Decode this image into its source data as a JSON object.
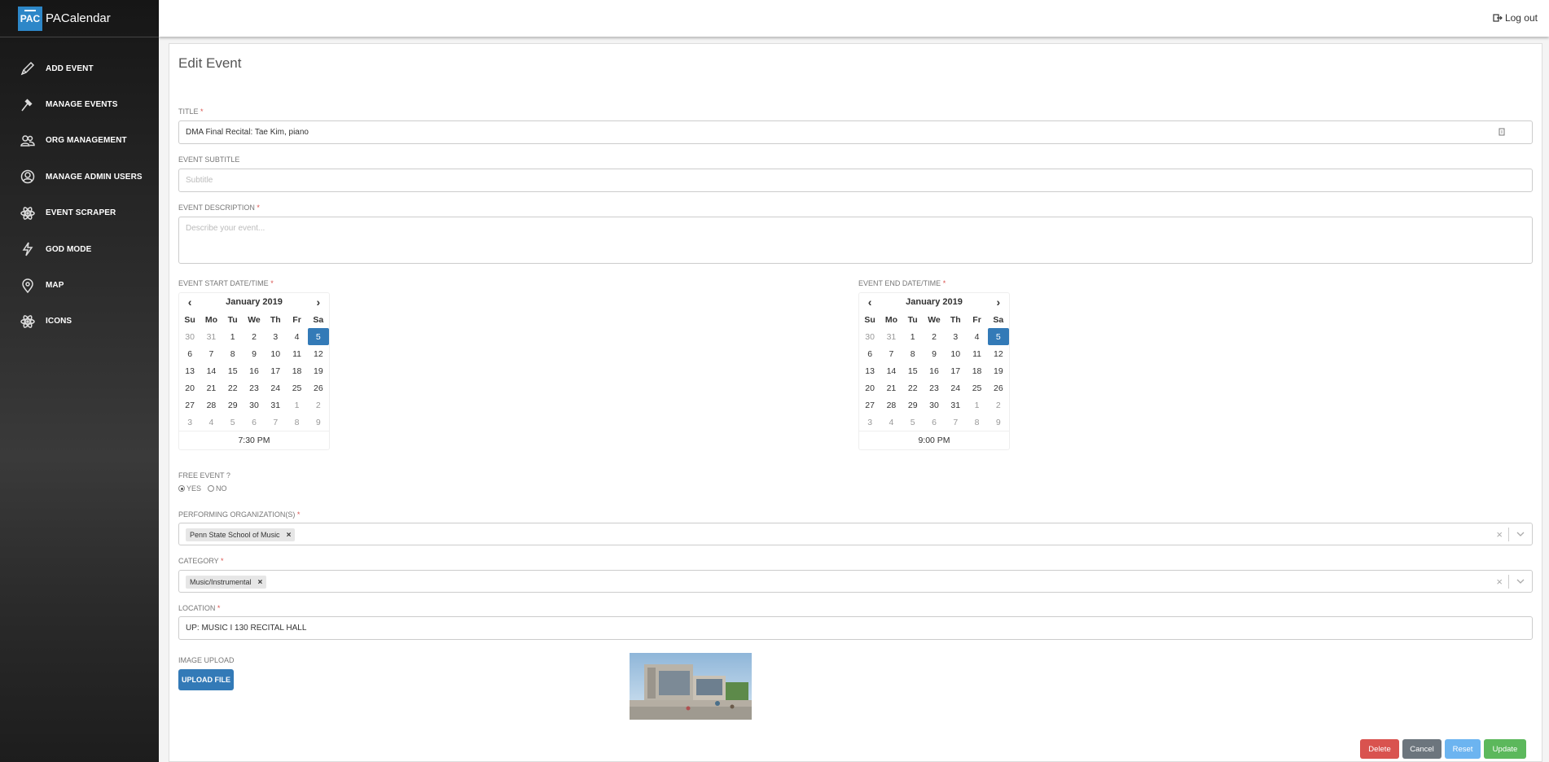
{
  "brand": {
    "logo_text": "PAC",
    "name": "PACalendar"
  },
  "sidebar": {
    "items": [
      {
        "label": "ADD EVENT",
        "icon": "pencil-icon"
      },
      {
        "label": "MANAGE EVENTS",
        "icon": "gavel-icon"
      },
      {
        "label": "ORG MANAGEMENT",
        "icon": "users-icon"
      },
      {
        "label": "MANAGE ADMIN USERS",
        "icon": "user-circle-icon"
      },
      {
        "label": "EVENT SCRAPER",
        "icon": "atom-icon"
      },
      {
        "label": "GOD MODE",
        "icon": "lightning-icon"
      },
      {
        "label": "MAP",
        "icon": "map-pin-icon"
      },
      {
        "label": "ICONS",
        "icon": "atom-icon"
      }
    ]
  },
  "topbar": {
    "logout_label": "Log out"
  },
  "form": {
    "page_title": "Edit Event",
    "title": {
      "label": "TITLE",
      "value": "DMA Final Recital: Tae Kim, piano"
    },
    "subtitle": {
      "label": "EVENT SUBTITLE",
      "placeholder": "Subtitle"
    },
    "description": {
      "label": "EVENT DESCRIPTION",
      "placeholder": "Describe your event..."
    },
    "start": {
      "label": "EVENT START DATE/TIME",
      "month": "January 2019",
      "time": "7:30 PM",
      "selected_day": "5"
    },
    "end": {
      "label": "EVENT END DATE/TIME",
      "month": "January 2019",
      "time": "9:00 PM",
      "selected_day": "5"
    },
    "weekdays": [
      "Su",
      "Mo",
      "Tu",
      "We",
      "Th",
      "Fr",
      "Sa"
    ],
    "weeks": [
      [
        "30",
        "31",
        "1",
        "2",
        "3",
        "4",
        "5"
      ],
      [
        "6",
        "7",
        "8",
        "9",
        "10",
        "11",
        "12"
      ],
      [
        "13",
        "14",
        "15",
        "16",
        "17",
        "18",
        "19"
      ],
      [
        "20",
        "21",
        "22",
        "23",
        "24",
        "25",
        "26"
      ],
      [
        "27",
        "28",
        "29",
        "30",
        "31",
        "1",
        "2"
      ],
      [
        "3",
        "4",
        "5",
        "6",
        "7",
        "8",
        "9"
      ]
    ],
    "free_event": {
      "label": "FREE EVENT ?",
      "yes": "YES",
      "no": "NO",
      "selected": "YES"
    },
    "performing_org": {
      "label": "PERFORMING ORGANIZATION(S)",
      "tag": "Penn State School of Music"
    },
    "category": {
      "label": "CATEGORY",
      "tag": "Music/Instrumental"
    },
    "location": {
      "label": "LOCATION",
      "value": "UP: MUSIC I 130 RECITAL HALL"
    },
    "image_upload": {
      "label": "IMAGE UPLOAD",
      "button": "UPLOAD FILE"
    },
    "required_mark": "*"
  },
  "actions": {
    "delete": "Delete",
    "cancel": "Cancel",
    "reset": "Reset",
    "update": "Update"
  },
  "colors": {
    "primary": "#337ab7",
    "danger": "#d9534f",
    "success": "#5cb85c",
    "info": "#6cb4f0",
    "secondary": "#6c757d"
  }
}
